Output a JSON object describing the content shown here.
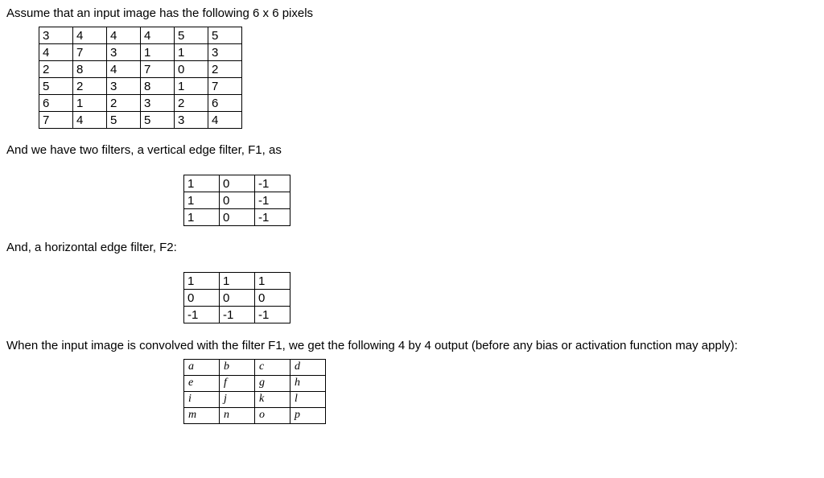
{
  "intro": "Assume that an input image has the following 6 x 6 pixels",
  "image_pixels": [
    [
      "3",
      "4",
      "4",
      "4",
      "5",
      "5"
    ],
    [
      "4",
      "7",
      "3",
      "1",
      "1",
      "3"
    ],
    [
      "2",
      "8",
      "4",
      "7",
      "0",
      "2"
    ],
    [
      "5",
      "2",
      "3",
      "8",
      "1",
      "7"
    ],
    [
      "6",
      "1",
      "2",
      "3",
      "2",
      "6"
    ],
    [
      "7",
      "4",
      "5",
      "5",
      "3",
      "4"
    ]
  ],
  "filter1_text": "And we have two filters, a vertical edge filter, F1, as",
  "filter1": [
    [
      "1",
      "0",
      "-1"
    ],
    [
      "1",
      "0",
      "-1"
    ],
    [
      "1",
      "0",
      "-1"
    ]
  ],
  "filter2_text": "And, a horizontal edge filter, F2:",
  "filter2": [
    [
      "1",
      "1",
      "1"
    ],
    [
      "0",
      "0",
      "0"
    ],
    [
      "-1",
      "-1",
      "-1"
    ]
  ],
  "output_text": "When the input image is convolved with the filter F1, we get the following 4 by 4 output (before any bias or activation function may apply):",
  "output": [
    [
      "a",
      "b",
      "c",
      "d"
    ],
    [
      "e",
      "f",
      "g",
      "h"
    ],
    [
      "i",
      "j",
      "k",
      "l"
    ],
    [
      "m",
      "n",
      "o",
      "p"
    ]
  ]
}
